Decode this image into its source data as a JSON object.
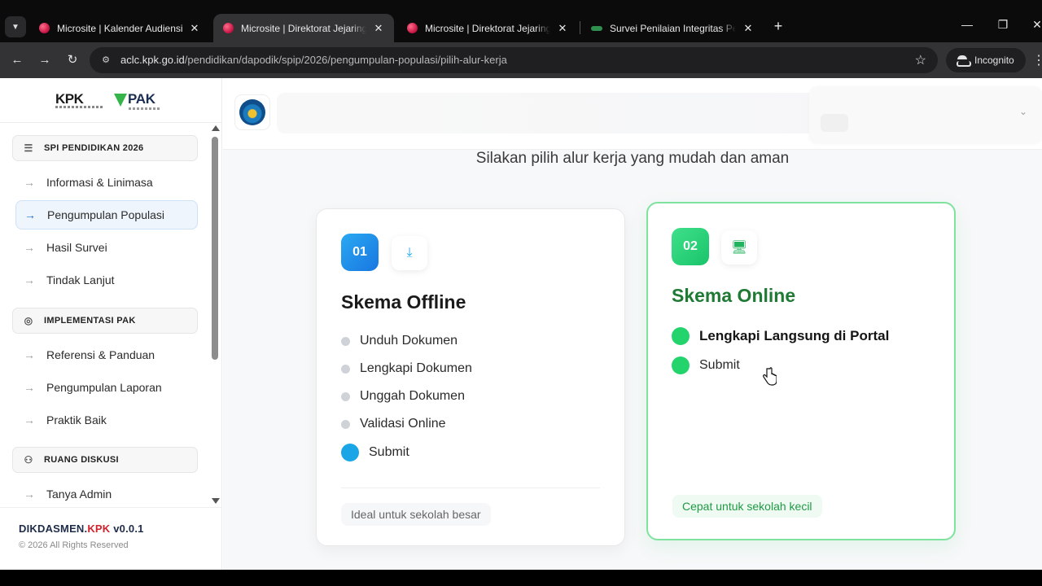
{
  "browser": {
    "tab_search_icon": "chevron-down-icon",
    "tabs": [
      {
        "title": "Microsite | Kalender Audiensi",
        "favicon": "kpk-heart-icon"
      },
      {
        "title": "Microsite | Direktorat Jejaring Pendidikan",
        "favicon": "kpk-heart-icon"
      },
      {
        "title": "Microsite | Direktorat Jejaring Pendidikan",
        "favicon": "kpk-heart-icon"
      },
      {
        "title": "Survei Penilaian Integritas Pendidikan",
        "favicon": "spi-icon"
      }
    ],
    "active_tab_index": 1,
    "url_host": "aclc.kpk.go.id",
    "url_path": "/pendidikan/dapodik/spip/2026/pengumpulan-populasi/pilih-alur-kerja",
    "profile_label": "Incognito"
  },
  "sidebar": {
    "logo_left": "KPK",
    "logo_right": "PAK",
    "sections": [
      {
        "label": "SPI PENDIDIKAN 2026",
        "icon": "list-icon",
        "items": [
          "Informasi & Linimasa",
          "Pengumpulan Populasi",
          "Hasil Survei",
          "Tindak Lanjut"
        ]
      },
      {
        "label": "IMPLEMENTASI PAK",
        "icon": "target-icon",
        "items": [
          "Referensi & Panduan",
          "Pengumpulan Laporan",
          "Praktik Baik"
        ]
      },
      {
        "label": "RUANG DISKUSI",
        "icon": "users-icon",
        "items": [
          "Tanya Admin"
        ]
      }
    ],
    "active_item": "Pengumpulan Populasi",
    "footer": {
      "brand_a": "DIKDASMEN.",
      "brand_b": "KPK",
      "brand_c": " v0.0.1",
      "copyright": "© 2026 All Rights Reserved"
    }
  },
  "main": {
    "subtitle": "Silakan pilih alur kerja yang mudah dan aman",
    "offline": {
      "number": "01",
      "icon": "download-icon",
      "title": "Skema Offline",
      "steps": [
        "Unduh Dokumen",
        "Lengkapi Dokumen",
        "Unggah Dokumen",
        "Validasi Online",
        "Submit"
      ],
      "footer": "Ideal untuk sekolah besar"
    },
    "online": {
      "number": "02",
      "icon": "monitor-icon",
      "title": "Skema Online",
      "steps": [
        "Lengkapi Langsung di Portal",
        "Submit"
      ],
      "footer": "Cepat untuk sekolah kecil"
    }
  },
  "colors": {
    "accent_blue": "#1aa6e6",
    "accent_green": "#23d36b",
    "brand_red": "#d3202a"
  }
}
